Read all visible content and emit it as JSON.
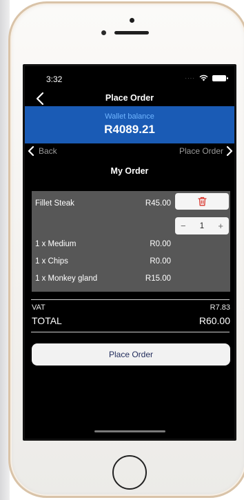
{
  "status_bar": {
    "time": "3:32"
  },
  "nav": {
    "title": "Place Order"
  },
  "wallet": {
    "label": "Wallet balance",
    "amount": "R4089.21"
  },
  "subnav": {
    "back_label": "Back",
    "next_label": "Place Order"
  },
  "section": {
    "title": "My Order"
  },
  "order": {
    "item": {
      "name": "Fillet Steak",
      "price": "R45.00",
      "quantity": "1"
    },
    "options": [
      {
        "label": "1 x Medium",
        "price": "R0.00"
      },
      {
        "label": "1 x Chips",
        "price": "R0.00"
      },
      {
        "label": "1 x Monkey gland",
        "price": "R15.00"
      }
    ]
  },
  "totals": {
    "vat_label": "VAT",
    "vat_value": "R7.83",
    "total_label": "TOTAL",
    "total_value": "R60.00"
  },
  "actions": {
    "place_order_label": "Place Order"
  },
  "colors": {
    "wallet_bg": "#1a5bb5",
    "wallet_label": "#6fb4ff",
    "delete_icon": "#d9342b",
    "button_text": "#1f2a5a"
  },
  "icons": {
    "back": "chevron-left-icon",
    "delete": "trash-icon",
    "wifi": "wifi-icon",
    "battery": "battery-icon"
  }
}
